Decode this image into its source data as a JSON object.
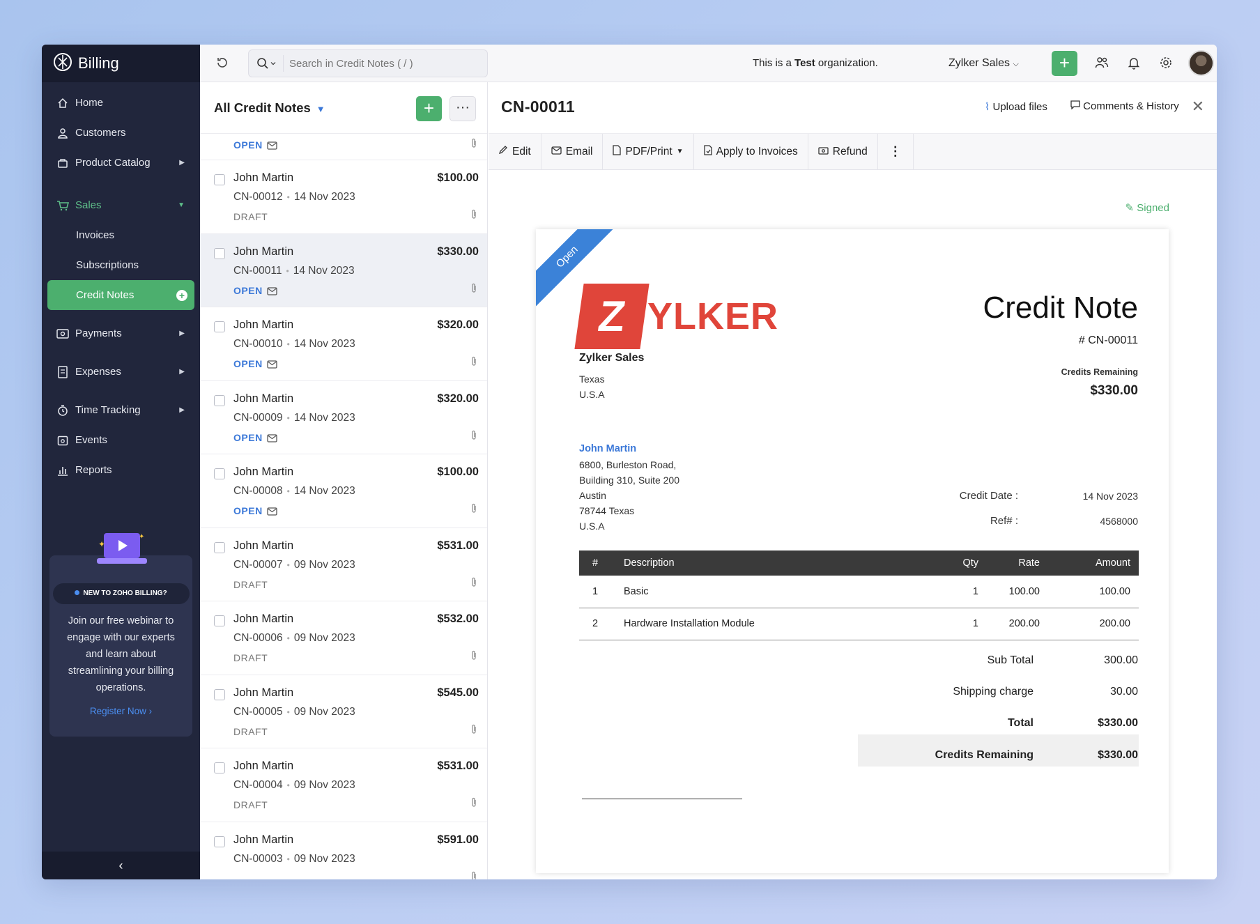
{
  "app": {
    "name": "Billing"
  },
  "sidebar": {
    "items": [
      {
        "label": "Home",
        "icon": "home-icon"
      },
      {
        "label": "Customers",
        "icon": "user-icon"
      },
      {
        "label": "Product Catalog",
        "icon": "box-icon"
      }
    ],
    "sales": {
      "label": "Sales",
      "icon": "cart-icon"
    },
    "sales_sub": [
      "Invoices",
      "Subscriptions",
      "Credit Notes"
    ],
    "lower_items": [
      {
        "label": "Payments",
        "icon": "payment-icon"
      },
      {
        "label": "Expenses",
        "icon": "receipt-icon"
      },
      {
        "label": "Time Tracking",
        "icon": "clock-icon"
      },
      {
        "label": "Events",
        "icon": "calendar-icon"
      },
      {
        "label": "Reports",
        "icon": "bar-chart-icon"
      }
    ],
    "promo": {
      "badge": "NEW TO ZOHO BILLING?",
      "text": "Join our free webinar to engage with our experts and learn about streamlining your billing operations.",
      "link": "Register Now ›"
    }
  },
  "topbar": {
    "search_placeholder": "Search in Credit Notes ( / )",
    "org_note_prefix": "This is a ",
    "org_note_bold": "Test",
    "org_note_suffix": " organization.",
    "org_name": "Zylker Sales"
  },
  "list": {
    "title": "All Credit Notes",
    "partial_status": "OPEN",
    "rows": [
      {
        "name": "John Martin",
        "number": "CN-00012",
        "date": "14 Nov 2023",
        "amount": "$100.00",
        "status": "DRAFT"
      },
      {
        "name": "John Martin",
        "number": "CN-00011",
        "date": "14 Nov 2023",
        "amount": "$330.00",
        "status": "OPEN"
      },
      {
        "name": "John Martin",
        "number": "CN-00010",
        "date": "14 Nov 2023",
        "amount": "$320.00",
        "status": "OPEN"
      },
      {
        "name": "John Martin",
        "number": "CN-00009",
        "date": "14 Nov 2023",
        "amount": "$320.00",
        "status": "OPEN"
      },
      {
        "name": "John Martin",
        "number": "CN-00008",
        "date": "14 Nov 2023",
        "amount": "$100.00",
        "status": "OPEN"
      },
      {
        "name": "John Martin",
        "number": "CN-00007",
        "date": "09 Nov 2023",
        "amount": "$531.00",
        "status": "DRAFT"
      },
      {
        "name": "John Martin",
        "number": "CN-00006",
        "date": "09 Nov 2023",
        "amount": "$532.00",
        "status": "DRAFT"
      },
      {
        "name": "John Martin",
        "number": "CN-00005",
        "date": "09 Nov 2023",
        "amount": "$545.00",
        "status": "DRAFT"
      },
      {
        "name": "John Martin",
        "number": "CN-00004",
        "date": "09 Nov 2023",
        "amount": "$531.00",
        "status": "DRAFT"
      },
      {
        "name": "John Martin",
        "number": "CN-00003",
        "date": "09 Nov 2023",
        "amount": "$591.00",
        "status": ""
      }
    ]
  },
  "detail": {
    "title": "CN-00011",
    "upload": "Upload files",
    "comments": "Comments & History",
    "toolbar": [
      "Edit",
      "Email",
      "PDF/Print",
      "Apply to Invoices",
      "Refund"
    ],
    "signed": "Signed",
    "doc": {
      "ribbon": "Open",
      "logo_initial": "Z",
      "logo_rest": "YLKER",
      "from_name": "Zylker Sales",
      "from_lines": [
        "Texas",
        "U.S.A"
      ],
      "heading": "Credit Note",
      "number": "# CN-00011",
      "credits_label": "Credits Remaining",
      "credits_value": "$330.00",
      "to_name": "John Martin",
      "to_lines": [
        "6800, Burleston Road,",
        "Building 310, Suite 200",
        "Austin",
        "78744 Texas",
        "U.S.A"
      ],
      "credit_date_label": "Credit Date :",
      "credit_date": "14 Nov 2023",
      "ref_label": "Ref# :",
      "ref": "4568000",
      "columns": [
        "#",
        "Description",
        "Qty",
        "Rate",
        "Amount"
      ],
      "items": [
        {
          "n": "1",
          "desc": "Basic",
          "qty": "1",
          "rate": "100.00",
          "amount": "100.00"
        },
        {
          "n": "2",
          "desc": "Hardware Installation Module",
          "qty": "1",
          "rate": "200.00",
          "amount": "200.00"
        }
      ],
      "subtotal_label": "Sub Total",
      "subtotal": "300.00",
      "shipping_label": "Shipping charge",
      "shipping": "30.00",
      "total_label": "Total",
      "total": "$330.00",
      "remaining_label": "Credits Remaining",
      "remaining": "$330.00"
    }
  },
  "colors": {
    "accent_green": "#4caf6e",
    "link_blue": "#3b78d8",
    "sidebar_bg": "#21263c",
    "logo_red": "#e0453a"
  }
}
